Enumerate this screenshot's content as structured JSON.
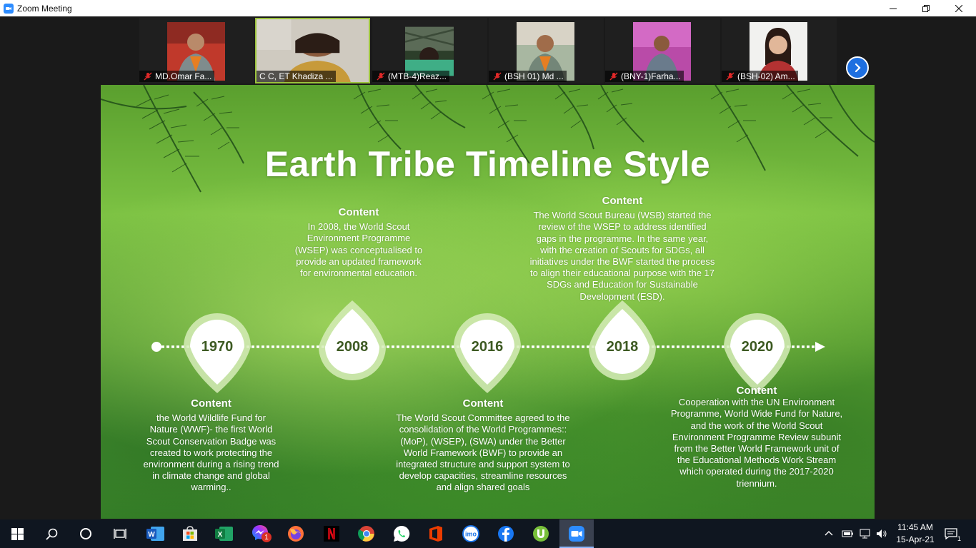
{
  "window": {
    "title": "Zoom Meeting"
  },
  "participants": [
    {
      "name": "MD.Omar Fa...",
      "muted": true
    },
    {
      "name": "C C, ET Khadiza ...",
      "muted": false,
      "active": true
    },
    {
      "name": "(MTB-4)Reaz...",
      "muted": true
    },
    {
      "name": "(BSH 01) Md ...",
      "muted": true
    },
    {
      "name": "(BNY-1)Farha...",
      "muted": true
    },
    {
      "name": "(BSH-02) Am...",
      "muted": true
    }
  ],
  "slide": {
    "title": "Earth Tribe Timeline Style",
    "milestones": [
      {
        "year": "1970",
        "heading": "Content",
        "text": "the World Wildlife Fund for Nature (WWF)- the first World Scout Conservation Badge was created to work protecting the environment during a rising trend in climate change and global warming.."
      },
      {
        "year": "2008",
        "heading": "Content",
        "text": "In 2008, the World Scout Environment Programme (WSEP) was conceptualised to provide an updated framework for environmental education."
      },
      {
        "year": "2016",
        "heading": "Content",
        "text": "The World Scout Committee agreed to the consolidation of the World Programmes:: (MoP), (WSEP), (SWA) under the Better World Framework (BWF) to provide an integrated structure and support system to develop capacities, streamline resources and align shared goals"
      },
      {
        "year": "2018",
        "heading": "Content",
        "text": "The World Scout Bureau (WSB) started the review of the WSEP to address identified gaps in the programme. In the same year, with the creation of Scouts for SDGs, all initiatives under the BWF started the process to align their educational purpose with the 17 SDGs and Education for Sustainable Development (ESD)."
      },
      {
        "year": "2020",
        "heading": "Content",
        "text": "Cooperation with the UN Environment Programme, World Wide Fund for Nature, and the work of the World Scout Environment Programme Review subunit from the Better World Framework unit of the Educational Methods Work Stream which operated during the 2017-2020 triennium."
      }
    ]
  },
  "taskbar": {
    "apps": [
      "windows-start",
      "search",
      "cortana",
      "task-view",
      "word",
      "store",
      "excel",
      "messenger",
      "firefox",
      "netflix",
      "chrome",
      "whatsapp",
      "office",
      "imo",
      "facebook",
      "utorrent",
      "zoom"
    ],
    "messenger_badge": "1",
    "imo_label": "imo",
    "time": "11:45 AM",
    "date": "15-Apr-21",
    "notification_count": "1"
  },
  "colors": {
    "zoom_blue": "#2d8cff",
    "active_speaker_border": "#9bc23c",
    "taskbar": "#0f1620",
    "year_text": "#3d5a22"
  }
}
